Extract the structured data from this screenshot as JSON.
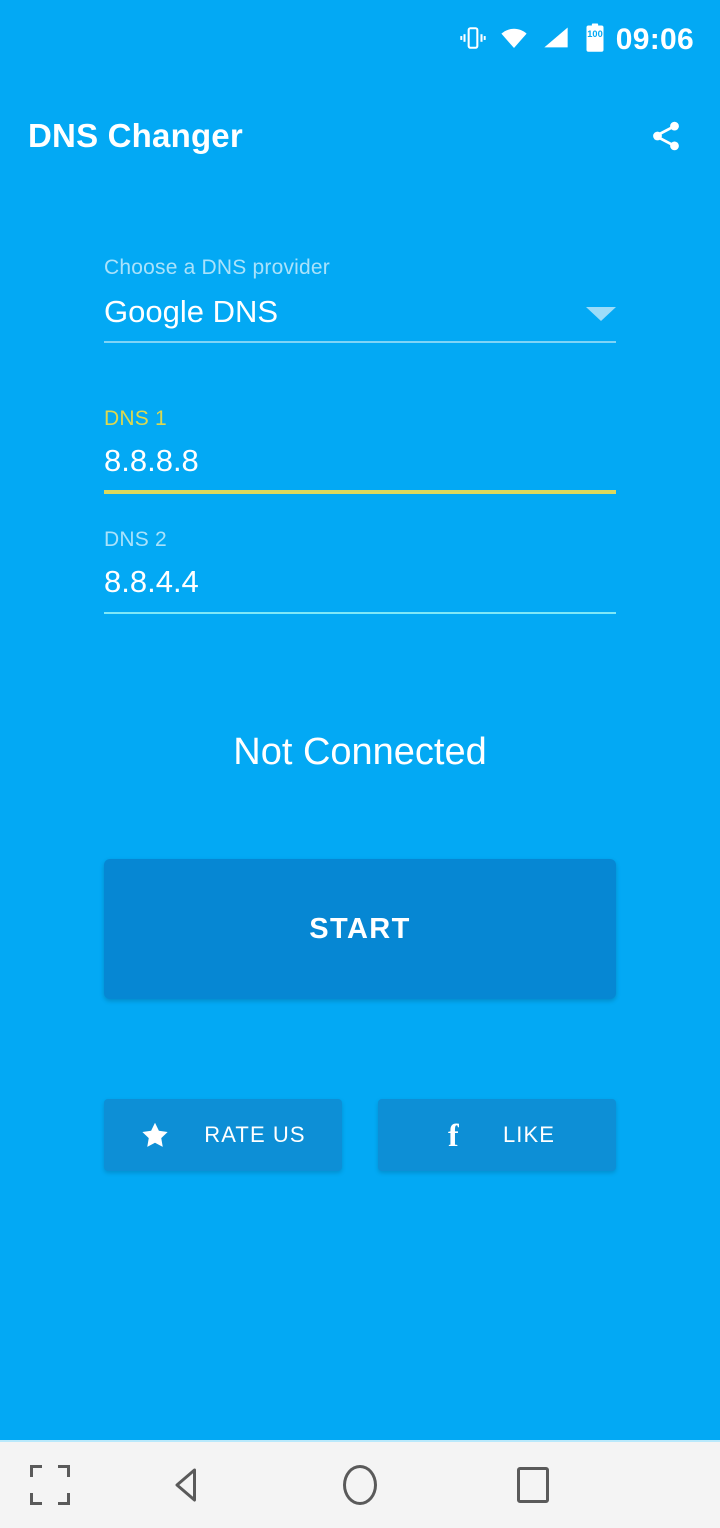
{
  "status_bar": {
    "time": "09:06",
    "battery_level": "100",
    "icons": [
      "vibrate-icon",
      "wifi-icon",
      "signal-icon",
      "battery-icon"
    ]
  },
  "app_bar": {
    "title": "DNS Changer",
    "share_icon": "share-icon"
  },
  "provider": {
    "label": "Choose a DNS provider",
    "selected": "Google DNS",
    "caret_icon": "chevron-down-icon"
  },
  "dns1": {
    "label": "DNS 1",
    "value": "8.8.8.8"
  },
  "dns2": {
    "label": "DNS 2",
    "value": "8.8.4.4"
  },
  "connection": {
    "status_text": "Not Connected"
  },
  "actions": {
    "start_label": "START",
    "rate_label": "RATE US",
    "rate_icon": "star-icon",
    "like_label": "LIKE",
    "like_icon": "facebook-icon",
    "facebook_glyph": "f"
  },
  "nav_bar": {
    "collapse_icon": "collapse-icon",
    "back_icon": "back-triangle-icon",
    "home_icon": "home-circle-icon",
    "recents_icon": "recents-square-icon"
  },
  "colors": {
    "background": "#03a9f4",
    "primary_button": "#0687d3",
    "social_button": "#0d8fd6",
    "dns1_accent": "#ddd84f",
    "dns2_accent": "#7fe8f8",
    "muted_label": "#a9e2fb",
    "nav_background": "#f4f4f4"
  }
}
